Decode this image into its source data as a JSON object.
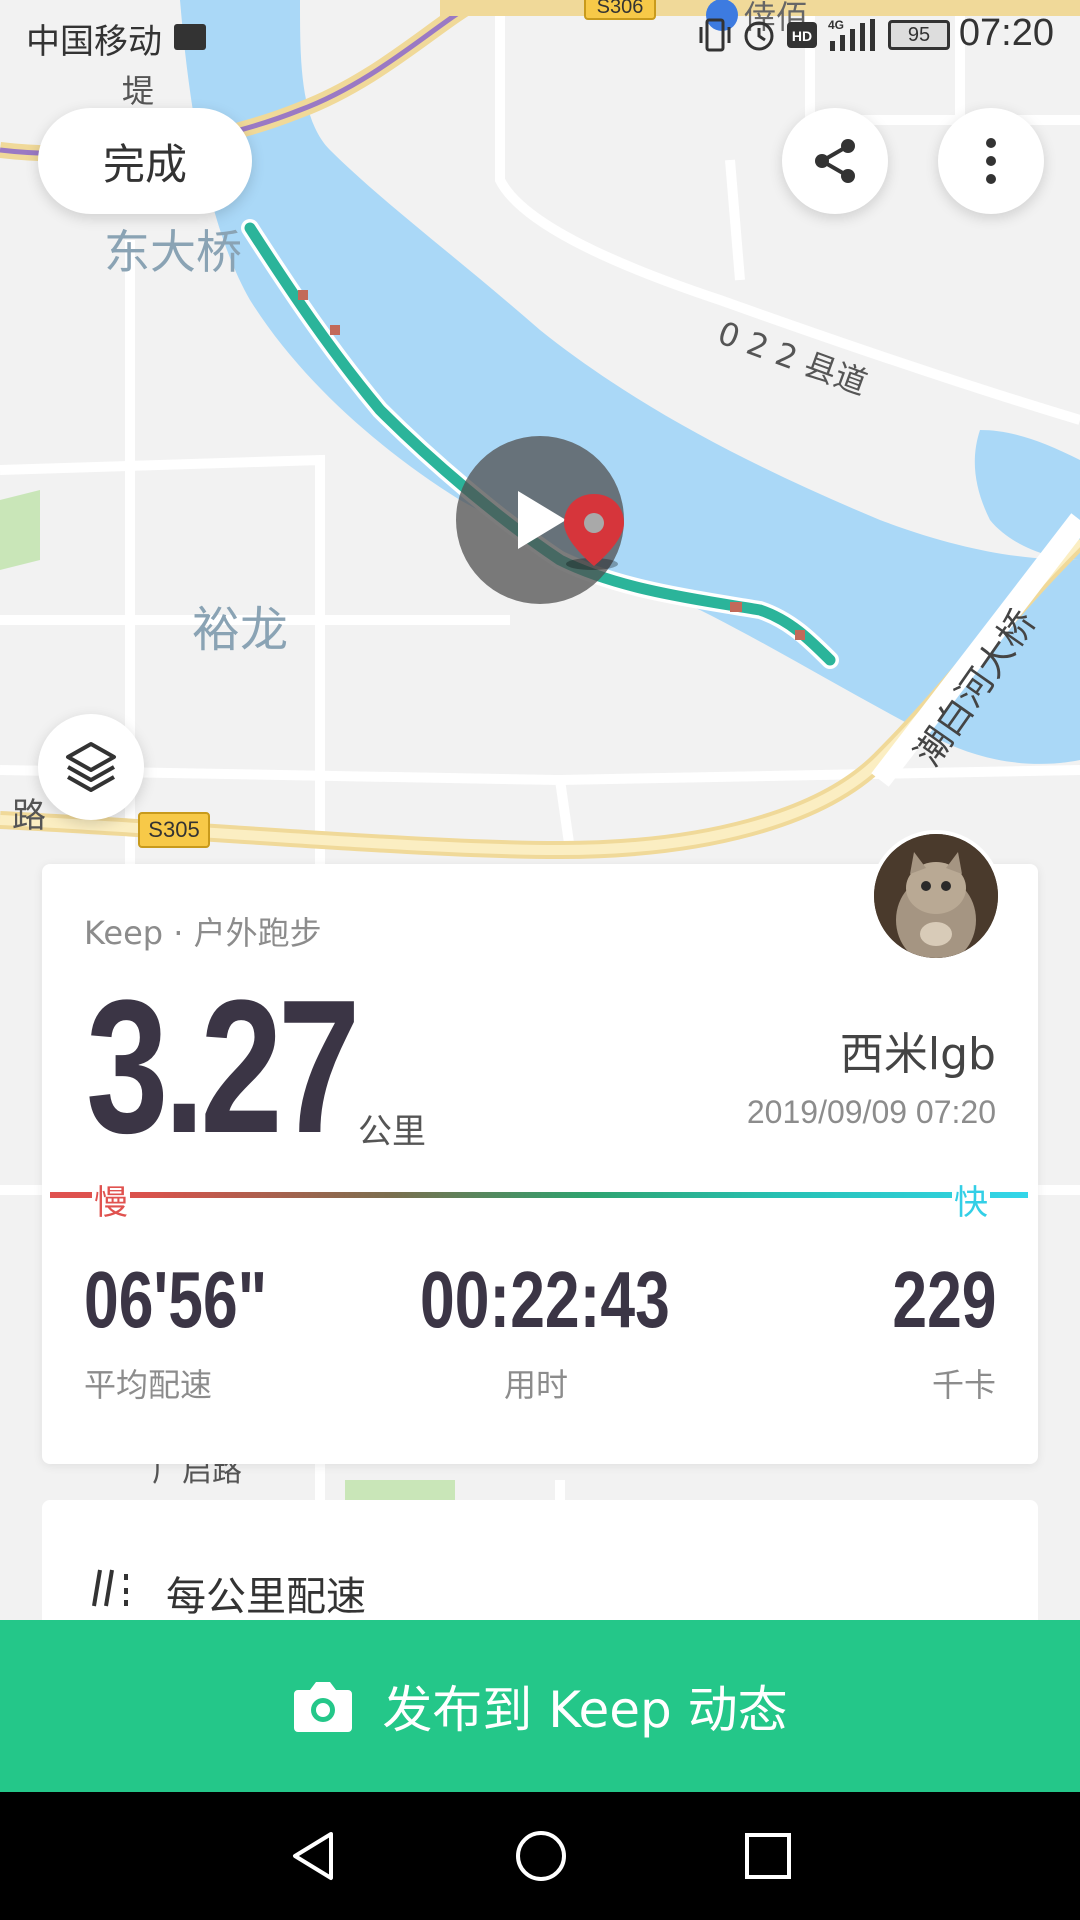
{
  "status_bar": {
    "carrier": "中国移动",
    "battery": "95",
    "time": "07:20"
  },
  "map": {
    "labels": {
      "bridge_east": "东大桥",
      "county_road": "0 2 2 县道",
      "yulong": "裕龙",
      "chaobai_bridge": "潮白河大桥",
      "road_s305": "S305",
      "road_s306": "S306",
      "poi": "倖佰",
      "di": "堤",
      "lu": "路",
      "road_bottom": "广启路"
    },
    "colors": {
      "water": "#aad8f7",
      "land": "#f2f2f2",
      "highway": "#f8e6a0",
      "track": "#2bb49a",
      "pin": "#d6353b"
    }
  },
  "controls": {
    "done_label": "完成",
    "share_icon": "share-icon",
    "more_icon": "more-vertical-icon",
    "layers_icon": "layers-icon",
    "play_icon": "play-icon"
  },
  "stats": {
    "source": "Keep · 户外跑步",
    "distance": "3.27",
    "distance_unit": "公里",
    "username": "西米lgb",
    "datetime": "2019/09/09 07:20",
    "slow_label": "慢",
    "fast_label": "快",
    "pace_value": "06'56\"",
    "pace_label": "平均配速",
    "duration_value": "00:22:43",
    "duration_label": "用时",
    "calories_value": "229",
    "calories_label": "千卡"
  },
  "pace_section": {
    "title": "每公里配速"
  },
  "publish": {
    "label": "发布到 Keep 动态",
    "icon": "camera-icon",
    "color": "#24c789"
  },
  "nav": {
    "back_icon": "back-triangle-icon",
    "home_icon": "home-circle-icon",
    "recents_icon": "recents-square-icon"
  }
}
